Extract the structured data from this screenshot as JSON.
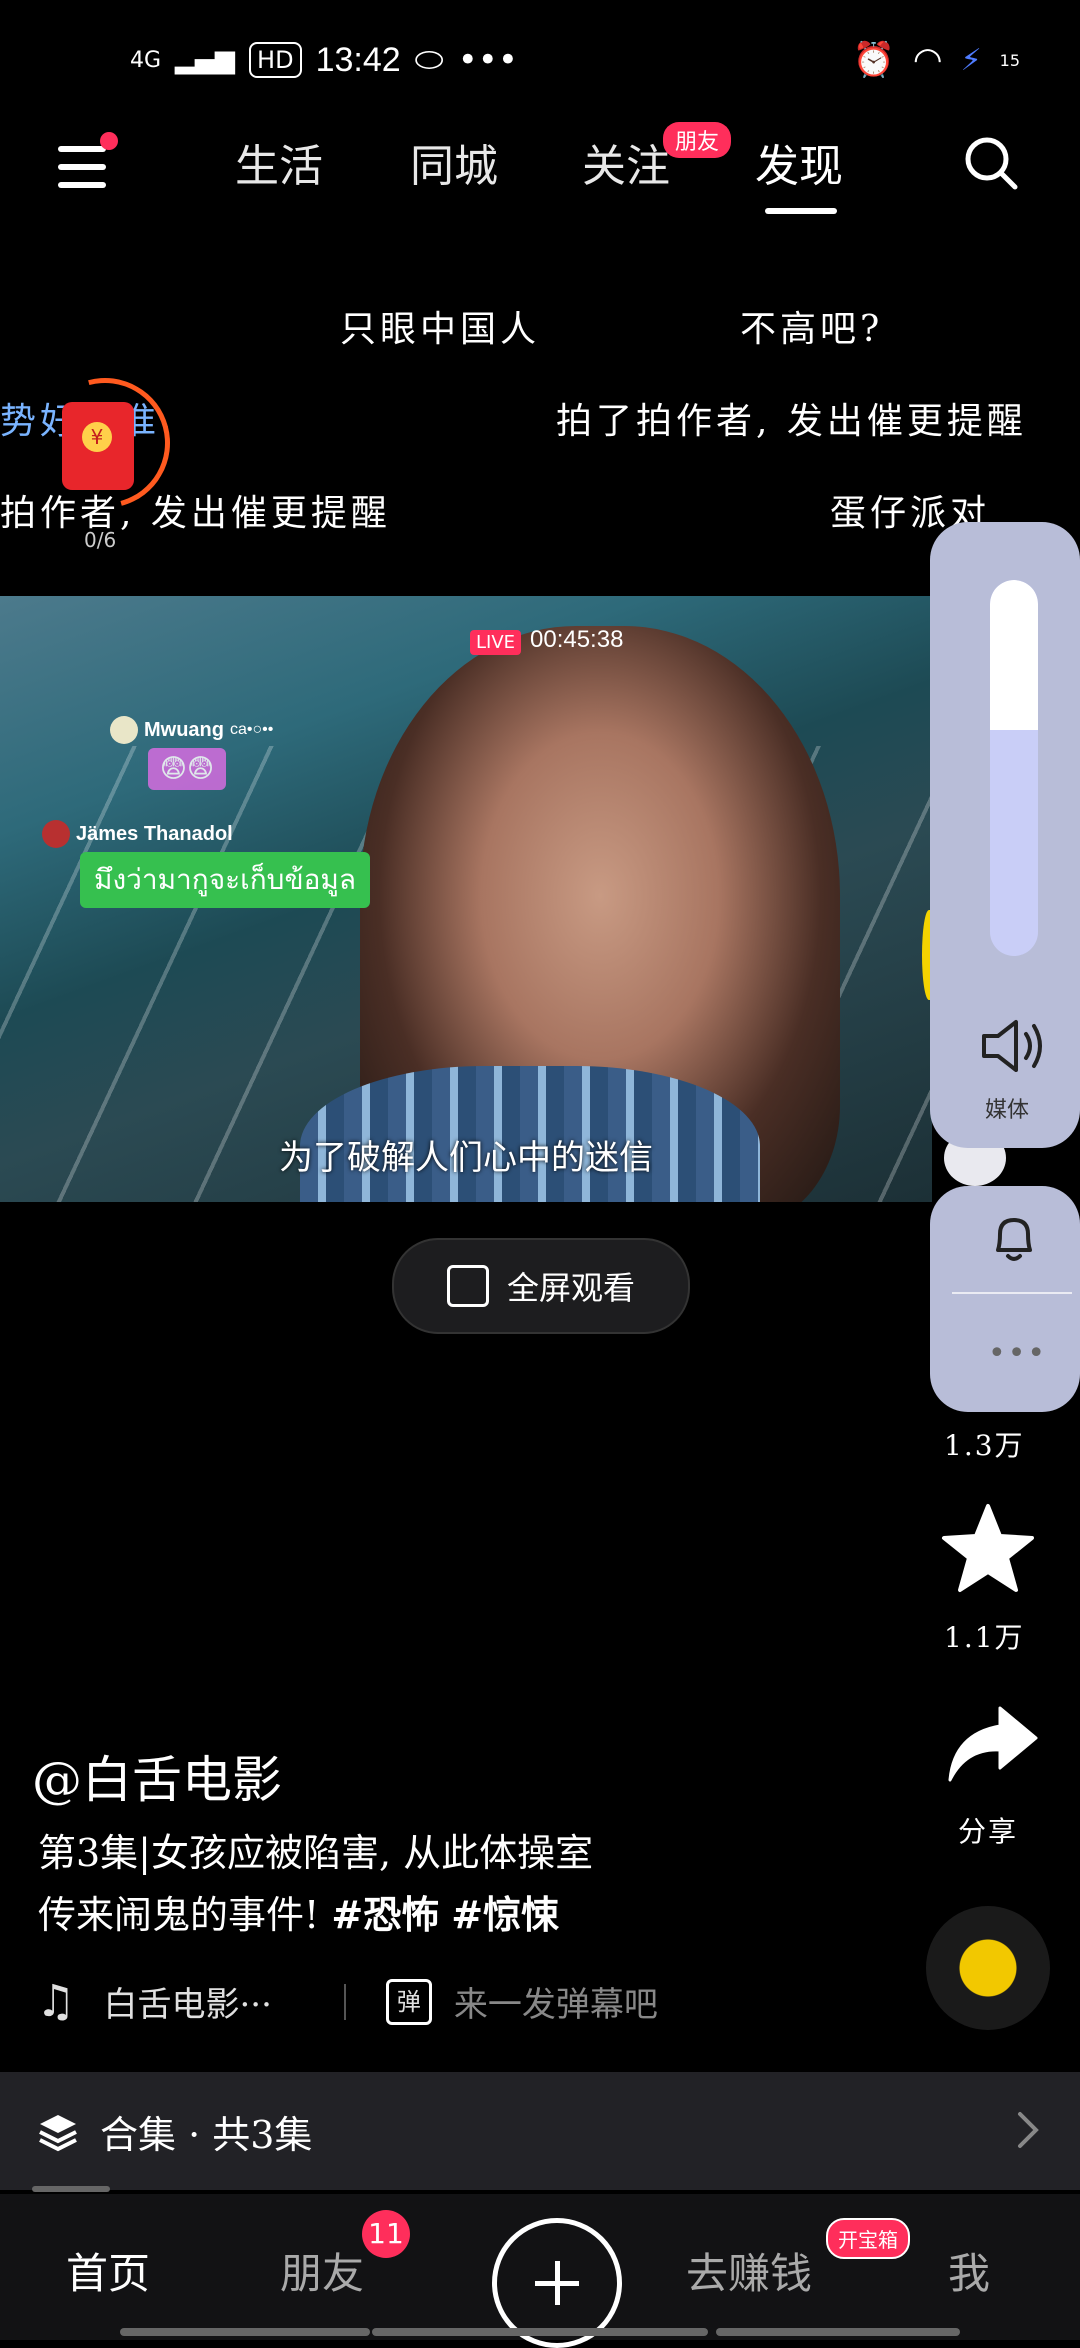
{
  "status_bar": {
    "network": "4G",
    "hd": "HD",
    "time": "13:42",
    "battery": "15"
  },
  "top_nav": {
    "tabs": [
      "生活",
      "同城",
      "关注",
      "发现"
    ],
    "active_tab": "发现",
    "friend_badge": "朋友"
  },
  "danmaku": {
    "lines": [
      "只眼中国人",
      "不高吧?",
      "势好",
      "准",
      "拍了拍作者, 发出催更提醒",
      "拍作者, 发出催更提醒",
      "蛋仔派对"
    ],
    "red_packet_count": "0/6"
  },
  "video": {
    "live_label": "LIVE",
    "live_time": "00:45:38",
    "chat_user1": "Mwuang",
    "chat_user1_suffix": "ca•○••",
    "chat_emoji": "😨😨",
    "chat_user2": "Jämes Thanadol",
    "chat_thai": "มึงว่ามากูจะเก็บข้อมูล",
    "subtitle": "为了破解人们心中的迷信"
  },
  "fullscreen_label": "全屏观看",
  "volume": {
    "label": "媒体",
    "level": 0.6
  },
  "side": {
    "count1": "1.3万",
    "star_count": "1.1万",
    "share_label": "分享"
  },
  "post": {
    "author": "@白舌电影",
    "desc_line1": "第3集|女孩应被陷害, 从此体操室",
    "desc_line2": "传来闹鬼的事件! ",
    "tag1": "#恐怖",
    "tag2": "#惊悚",
    "music": "白舌电影···",
    "danmu_btn": "弹",
    "danmu_placeholder": "来一发弹幕吧"
  },
  "collection": {
    "label": "合集 · 共3集"
  },
  "bottom_nav": {
    "home": "首页",
    "friends": "朋友",
    "friends_badge": "11",
    "earn": "去赚钱",
    "earn_badge": "开宝箱",
    "me": "我"
  },
  "colors": {
    "accent": "#ff2e5b",
    "panel": "#b8bdd8",
    "background": "#000000"
  }
}
